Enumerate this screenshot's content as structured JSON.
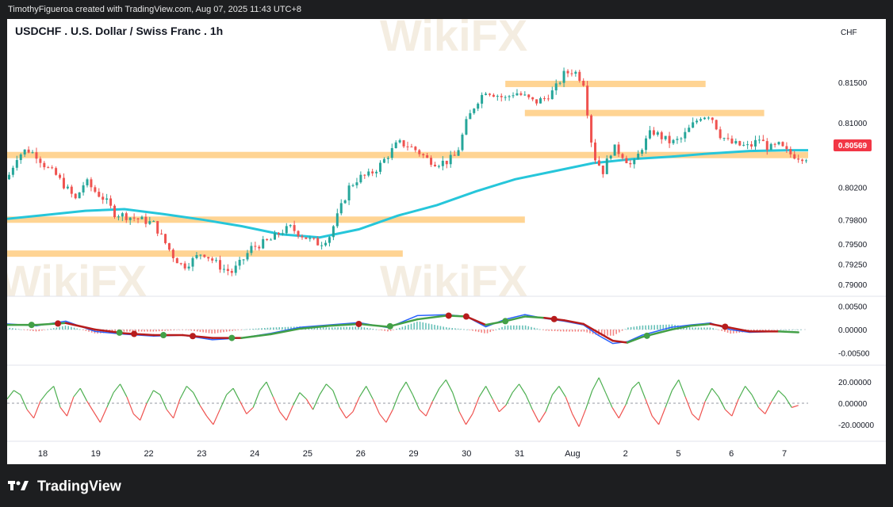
{
  "header": {
    "attribution": "TimothyFigueroa created with TradingView.com, Aug 07, 2025 11:43 UTC+8"
  },
  "footer": {
    "brand": "TradingView"
  },
  "watermark": {
    "text": "WikiFX"
  },
  "colors": {
    "up": "#26a69a",
    "down": "#ef5350",
    "ma": "#26c6da",
    "zone": "#ffcc80",
    "price_badge": "#f23645",
    "macd_line": "#2962ff",
    "signal_up": "#43a047",
    "signal_down": "#b71c1c",
    "rsi_up": "#4caf50",
    "rsi_down": "#ef5350"
  },
  "chart_data": [
    {
      "type": "candlestick",
      "title": "USDCHF . U.S. Dollar / Swiss Franc . 1h",
      "currency_label": "CHF",
      "last_price": "0.80569",
      "ylim": [
        0.7895,
        0.8195
      ],
      "y_ticks": [
        "0.81500",
        "0.81000",
        "0.80200",
        "0.79800",
        "0.79500",
        "0.79250",
        "0.79000"
      ],
      "x_ticks": [
        "18",
        "19",
        "22",
        "23",
        "24",
        "25",
        "26",
        "29",
        "30",
        "31",
        "Aug",
        "2",
        "5",
        "6",
        "7"
      ],
      "close_path": [
        [
          0,
          0.803
        ],
        [
          10,
          0.8058
        ],
        [
          20,
          0.8067
        ],
        [
          30,
          0.806
        ],
        [
          40,
          0.8045
        ],
        [
          50,
          0.8035
        ],
        [
          60,
          0.802
        ],
        [
          70,
          0.8005
        ],
        [
          80,
          0.8028
        ],
        [
          90,
          0.8015
        ],
        [
          100,
          0.8005
        ],
        [
          110,
          0.7988
        ],
        [
          120,
          0.7985
        ],
        [
          130,
          0.7982
        ],
        [
          140,
          0.7979
        ],
        [
          150,
          0.7975
        ],
        [
          160,
          0.7955
        ],
        [
          170,
          0.7935
        ],
        [
          180,
          0.7922
        ],
        [
          190,
          0.793
        ],
        [
          200,
          0.794
        ],
        [
          210,
          0.793
        ],
        [
          220,
          0.792
        ],
        [
          230,
          0.7915
        ],
        [
          240,
          0.7928
        ],
        [
          250,
          0.7945
        ],
        [
          260,
          0.795
        ],
        [
          270,
          0.7955
        ],
        [
          280,
          0.7965
        ],
        [
          290,
          0.797
        ],
        [
          300,
          0.7962
        ],
        [
          310,
          0.7955
        ],
        [
          320,
          0.795
        ],
        [
          330,
          0.796
        ],
        [
          340,
          0.799
        ],
        [
          350,
          0.802
        ],
        [
          360,
          0.8032
        ],
        [
          370,
          0.8035
        ],
        [
          380,
          0.8045
        ],
        [
          390,
          0.806
        ],
        [
          400,
          0.8075
        ],
        [
          410,
          0.8072
        ],
        [
          420,
          0.8065
        ],
        [
          430,
          0.8055
        ],
        [
          440,
          0.805
        ],
        [
          450,
          0.8052
        ],
        [
          460,
          0.806
        ],
        [
          470,
          0.81
        ],
        [
          480,
          0.8125
        ],
        [
          490,
          0.814
        ],
        [
          500,
          0.8135
        ],
        [
          510,
          0.813
        ],
        [
          520,
          0.8138
        ],
        [
          530,
          0.8132
        ],
        [
          540,
          0.8125
        ],
        [
          550,
          0.813
        ],
        [
          560,
          0.814
        ],
        [
          570,
          0.816
        ],
        [
          580,
          0.8165
        ],
        [
          590,
          0.815
        ],
        [
          600,
          0.806
        ],
        [
          610,
          0.804
        ],
        [
          620,
          0.807
        ],
        [
          630,
          0.806
        ],
        [
          640,
          0.8045
        ],
        [
          650,
          0.807
        ],
        [
          660,
          0.809
        ],
        [
          670,
          0.8082
        ],
        [
          680,
          0.8075
        ],
        [
          690,
          0.808
        ],
        [
          700,
          0.8095
        ],
        [
          710,
          0.8108
        ],
        [
          720,
          0.811
        ],
        [
          730,
          0.8085
        ],
        [
          740,
          0.8075
        ],
        [
          750,
          0.8072
        ],
        [
          760,
          0.807
        ],
        [
          770,
          0.808
        ],
        [
          780,
          0.8068
        ],
        [
          790,
          0.8072
        ],
        [
          800,
          0.8062
        ],
        [
          810,
          0.8058
        ],
        [
          820,
          0.8057
        ]
      ],
      "ma_path": [
        [
          0,
          0.7981
        ],
        [
          40,
          0.7986
        ],
        [
          80,
          0.7991
        ],
        [
          120,
          0.7993
        ],
        [
          160,
          0.7987
        ],
        [
          200,
          0.798
        ],
        [
          240,
          0.7972
        ],
        [
          280,
          0.7962
        ],
        [
          320,
          0.7958
        ],
        [
          360,
          0.7968
        ],
        [
          400,
          0.7985
        ],
        [
          440,
          0.7998
        ],
        [
          480,
          0.8015
        ],
        [
          520,
          0.803
        ],
        [
          560,
          0.804
        ],
        [
          600,
          0.805
        ],
        [
          640,
          0.8055
        ],
        [
          680,
          0.8058
        ],
        [
          720,
          0.8062
        ],
        [
          760,
          0.8065
        ],
        [
          800,
          0.8066
        ],
        [
          820,
          0.8066
        ]
      ],
      "zones": [
        {
          "from": 0,
          "to": 820,
          "level": 0.806
        },
        {
          "from": 0,
          "to": 530,
          "level": 0.798
        },
        {
          "from": 0,
          "to": 405,
          "level": 0.7938
        },
        {
          "from": 510,
          "to": 715,
          "level": 0.8148
        },
        {
          "from": 530,
          "to": 775,
          "level": 0.8112
        }
      ]
    },
    {
      "type": "line",
      "indicator": "MACD",
      "y_ticks": [
        "0.00500",
        "0.00000",
        "-0.00500"
      ],
      "ylim": [
        -0.0068,
        0.0068
      ],
      "macd_path": [
        [
          0,
          0.0012
        ],
        [
          30,
          0.0008
        ],
        [
          60,
          0.0018
        ],
        [
          90,
          -0.0004
        ],
        [
          120,
          -0.001
        ],
        [
          150,
          -0.0014
        ],
        [
          180,
          -0.0012
        ],
        [
          210,
          -0.0022
        ],
        [
          240,
          -0.0018
        ],
        [
          270,
          -0.0008
        ],
        [
          300,
          0.0005
        ],
        [
          330,
          0.001
        ],
        [
          360,
          0.0015
        ],
        [
          390,
          0.0004
        ],
        [
          420,
          0.003
        ],
        [
          450,
          0.0032
        ],
        [
          470,
          0.0028
        ],
        [
          490,
          0.0006
        ],
        [
          510,
          0.0022
        ],
        [
          530,
          0.0032
        ],
        [
          550,
          0.0024
        ],
        [
          570,
          0.0018
        ],
        [
          590,
          0.001
        ],
        [
          605,
          -0.0012
        ],
        [
          620,
          -0.003
        ],
        [
          635,
          -0.0026
        ],
        [
          650,
          -0.0012
        ],
        [
          680,
          0.0005
        ],
        [
          700,
          0.001
        ],
        [
          720,
          0.0014
        ],
        [
          740,
          0.0
        ],
        [
          760,
          -0.0006
        ],
        [
          790,
          -0.0004
        ],
        [
          810,
          -0.0006
        ]
      ],
      "signal_path": [
        [
          0,
          0.001
        ],
        [
          30,
          0.001
        ],
        [
          60,
          0.0014
        ],
        [
          90,
          0.0
        ],
        [
          120,
          -0.0008
        ],
        [
          150,
          -0.0012
        ],
        [
          180,
          -0.0012
        ],
        [
          210,
          -0.0018
        ],
        [
          240,
          -0.0018
        ],
        [
          270,
          -0.001
        ],
        [
          300,
          0.0002
        ],
        [
          330,
          0.0008
        ],
        [
          360,
          0.0012
        ],
        [
          390,
          0.0006
        ],
        [
          420,
          0.0022
        ],
        [
          450,
          0.003
        ],
        [
          470,
          0.0028
        ],
        [
          490,
          0.001
        ],
        [
          510,
          0.0018
        ],
        [
          530,
          0.0028
        ],
        [
          550,
          0.0025
        ],
        [
          570,
          0.002
        ],
        [
          590,
          0.0012
        ],
        [
          605,
          -0.0006
        ],
        [
          620,
          -0.0024
        ],
        [
          635,
          -0.0028
        ],
        [
          650,
          -0.0016
        ],
        [
          680,
          0.0
        ],
        [
          700,
          0.0008
        ],
        [
          720,
          0.0012
        ],
        [
          740,
          0.0004
        ],
        [
          760,
          -0.0004
        ],
        [
          790,
          -0.0004
        ],
        [
          810,
          -0.0006
        ]
      ],
      "cross_points": [
        {
          "x": 25,
          "dir": "up"
        },
        {
          "x": 52,
          "dir": "down"
        },
        {
          "x": 115,
          "dir": "up"
        },
        {
          "x": 130,
          "dir": "down"
        },
        {
          "x": 160,
          "dir": "up"
        },
        {
          "x": 190,
          "dir": "down"
        },
        {
          "x": 230,
          "dir": "up"
        },
        {
          "x": 360,
          "dir": "down"
        },
        {
          "x": 392,
          "dir": "up"
        },
        {
          "x": 452,
          "dir": "down"
        },
        {
          "x": 470,
          "dir": "down"
        },
        {
          "x": 510,
          "dir": "up"
        },
        {
          "x": 560,
          "dir": "down"
        },
        {
          "x": 655,
          "dir": "up"
        },
        {
          "x": 735,
          "dir": "down"
        }
      ]
    },
    {
      "type": "line",
      "indicator": "Oscillator",
      "y_ticks": [
        "20.00000",
        "0.00000",
        "-20.00000"
      ],
      "ylim": [
        -32,
        32
      ],
      "values": [
        4,
        12,
        8,
        -6,
        -14,
        2,
        10,
        16,
        -4,
        -12,
        6,
        14,
        2,
        -8,
        -18,
        -4,
        10,
        18,
        6,
        -10,
        -16,
        0,
        12,
        8,
        -6,
        -14,
        4,
        16,
        10,
        -2,
        -12,
        -20,
        -6,
        8,
        14,
        2,
        -10,
        -4,
        12,
        20,
        6,
        -8,
        -16,
        -2,
        10,
        4,
        -6,
        8,
        18,
        12,
        -4,
        -14,
        -8,
        6,
        16,
        4,
        -10,
        -18,
        -6,
        10,
        20,
        8,
        -6,
        -12,
        2,
        14,
        22,
        10,
        -8,
        -20,
        -10,
        6,
        16,
        4,
        -8,
        -2,
        10,
        18,
        8,
        -6,
        -18,
        -8,
        8,
        16,
        6,
        -10,
        -22,
        -6,
        12,
        24,
        10,
        -4,
        -14,
        -2,
        14,
        20,
        4,
        -12,
        -20,
        -4,
        12,
        22,
        6,
        -10,
        -16,
        2,
        14,
        6,
        -6,
        -12,
        4,
        16,
        8,
        -4,
        -10,
        2,
        12,
        6,
        -4,
        -2
      ]
    }
  ]
}
